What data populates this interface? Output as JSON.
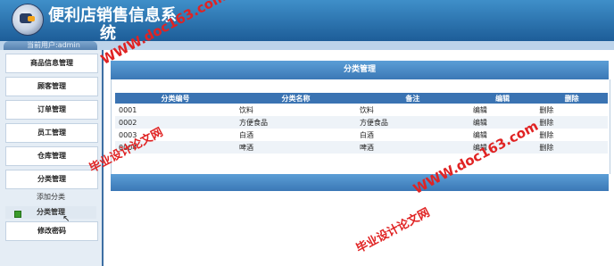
{
  "header": {
    "title_line1": "便利店销售信息系",
    "title_line2": "统"
  },
  "userbar": {
    "text": "当前用户:admin"
  },
  "sidebar": {
    "items": [
      {
        "label": "商品信息管理"
      },
      {
        "label": "顾客管理"
      },
      {
        "label": "订单管理"
      },
      {
        "label": "员工管理"
      },
      {
        "label": "仓库管理"
      },
      {
        "label": "分类管理"
      }
    ],
    "sub_items": [
      {
        "label": "添加分类"
      },
      {
        "label": "分类管理"
      }
    ],
    "change_password": "修改密码"
  },
  "panel": {
    "title": "分类管理"
  },
  "table": {
    "headers": [
      "分类编号",
      "分类名称",
      "备注",
      "编辑",
      "删除"
    ],
    "rows": [
      [
        "0001",
        "饮料",
        "饮料",
        "编辑",
        "删除"
      ],
      [
        "0002",
        "方便食品",
        "方便食品",
        "编辑",
        "删除"
      ],
      [
        "0003",
        "白酒",
        "白酒",
        "编辑",
        "删除"
      ],
      [
        "0004",
        "啤酒",
        "啤酒",
        "编辑",
        "删除"
      ]
    ]
  },
  "watermark": {
    "site": "WWW.doc163.com",
    "brand": "毕业设计论文网"
  },
  "colors": {
    "header": "#2c72b3",
    "watermark": "#e02323",
    "sidebar_bg": "#e5edf5"
  }
}
